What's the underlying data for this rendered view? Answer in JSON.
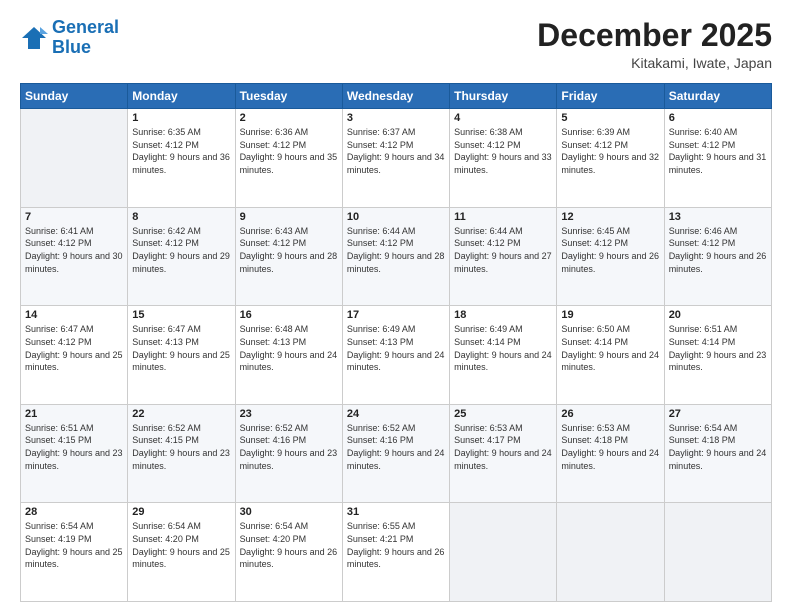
{
  "logo": {
    "line1": "General",
    "line2": "Blue"
  },
  "header": {
    "title": "December 2025",
    "location": "Kitakami, Iwate, Japan"
  },
  "weekdays": [
    "Sunday",
    "Monday",
    "Tuesday",
    "Wednesday",
    "Thursday",
    "Friday",
    "Saturday"
  ],
  "weeks": [
    [
      {
        "day": "",
        "sunrise": "",
        "sunset": "",
        "daylight": ""
      },
      {
        "day": "1",
        "sunrise": "Sunrise: 6:35 AM",
        "sunset": "Sunset: 4:12 PM",
        "daylight": "Daylight: 9 hours and 36 minutes."
      },
      {
        "day": "2",
        "sunrise": "Sunrise: 6:36 AM",
        "sunset": "Sunset: 4:12 PM",
        "daylight": "Daylight: 9 hours and 35 minutes."
      },
      {
        "day": "3",
        "sunrise": "Sunrise: 6:37 AM",
        "sunset": "Sunset: 4:12 PM",
        "daylight": "Daylight: 9 hours and 34 minutes."
      },
      {
        "day": "4",
        "sunrise": "Sunrise: 6:38 AM",
        "sunset": "Sunset: 4:12 PM",
        "daylight": "Daylight: 9 hours and 33 minutes."
      },
      {
        "day": "5",
        "sunrise": "Sunrise: 6:39 AM",
        "sunset": "Sunset: 4:12 PM",
        "daylight": "Daylight: 9 hours and 32 minutes."
      },
      {
        "day": "6",
        "sunrise": "Sunrise: 6:40 AM",
        "sunset": "Sunset: 4:12 PM",
        "daylight": "Daylight: 9 hours and 31 minutes."
      }
    ],
    [
      {
        "day": "7",
        "sunrise": "Sunrise: 6:41 AM",
        "sunset": "Sunset: 4:12 PM",
        "daylight": "Daylight: 9 hours and 30 minutes."
      },
      {
        "day": "8",
        "sunrise": "Sunrise: 6:42 AM",
        "sunset": "Sunset: 4:12 PM",
        "daylight": "Daylight: 9 hours and 29 minutes."
      },
      {
        "day": "9",
        "sunrise": "Sunrise: 6:43 AM",
        "sunset": "Sunset: 4:12 PM",
        "daylight": "Daylight: 9 hours and 28 minutes."
      },
      {
        "day": "10",
        "sunrise": "Sunrise: 6:44 AM",
        "sunset": "Sunset: 4:12 PM",
        "daylight": "Daylight: 9 hours and 28 minutes."
      },
      {
        "day": "11",
        "sunrise": "Sunrise: 6:44 AM",
        "sunset": "Sunset: 4:12 PM",
        "daylight": "Daylight: 9 hours and 27 minutes."
      },
      {
        "day": "12",
        "sunrise": "Sunrise: 6:45 AM",
        "sunset": "Sunset: 4:12 PM",
        "daylight": "Daylight: 9 hours and 26 minutes."
      },
      {
        "day": "13",
        "sunrise": "Sunrise: 6:46 AM",
        "sunset": "Sunset: 4:12 PM",
        "daylight": "Daylight: 9 hours and 26 minutes."
      }
    ],
    [
      {
        "day": "14",
        "sunrise": "Sunrise: 6:47 AM",
        "sunset": "Sunset: 4:12 PM",
        "daylight": "Daylight: 9 hours and 25 minutes."
      },
      {
        "day": "15",
        "sunrise": "Sunrise: 6:47 AM",
        "sunset": "Sunset: 4:13 PM",
        "daylight": "Daylight: 9 hours and 25 minutes."
      },
      {
        "day": "16",
        "sunrise": "Sunrise: 6:48 AM",
        "sunset": "Sunset: 4:13 PM",
        "daylight": "Daylight: 9 hours and 24 minutes."
      },
      {
        "day": "17",
        "sunrise": "Sunrise: 6:49 AM",
        "sunset": "Sunset: 4:13 PM",
        "daylight": "Daylight: 9 hours and 24 minutes."
      },
      {
        "day": "18",
        "sunrise": "Sunrise: 6:49 AM",
        "sunset": "Sunset: 4:14 PM",
        "daylight": "Daylight: 9 hours and 24 minutes."
      },
      {
        "day": "19",
        "sunrise": "Sunrise: 6:50 AM",
        "sunset": "Sunset: 4:14 PM",
        "daylight": "Daylight: 9 hours and 24 minutes."
      },
      {
        "day": "20",
        "sunrise": "Sunrise: 6:51 AM",
        "sunset": "Sunset: 4:14 PM",
        "daylight": "Daylight: 9 hours and 23 minutes."
      }
    ],
    [
      {
        "day": "21",
        "sunrise": "Sunrise: 6:51 AM",
        "sunset": "Sunset: 4:15 PM",
        "daylight": "Daylight: 9 hours and 23 minutes."
      },
      {
        "day": "22",
        "sunrise": "Sunrise: 6:52 AM",
        "sunset": "Sunset: 4:15 PM",
        "daylight": "Daylight: 9 hours and 23 minutes."
      },
      {
        "day": "23",
        "sunrise": "Sunrise: 6:52 AM",
        "sunset": "Sunset: 4:16 PM",
        "daylight": "Daylight: 9 hours and 23 minutes."
      },
      {
        "day": "24",
        "sunrise": "Sunrise: 6:52 AM",
        "sunset": "Sunset: 4:16 PM",
        "daylight": "Daylight: 9 hours and 24 minutes."
      },
      {
        "day": "25",
        "sunrise": "Sunrise: 6:53 AM",
        "sunset": "Sunset: 4:17 PM",
        "daylight": "Daylight: 9 hours and 24 minutes."
      },
      {
        "day": "26",
        "sunrise": "Sunrise: 6:53 AM",
        "sunset": "Sunset: 4:18 PM",
        "daylight": "Daylight: 9 hours and 24 minutes."
      },
      {
        "day": "27",
        "sunrise": "Sunrise: 6:54 AM",
        "sunset": "Sunset: 4:18 PM",
        "daylight": "Daylight: 9 hours and 24 minutes."
      }
    ],
    [
      {
        "day": "28",
        "sunrise": "Sunrise: 6:54 AM",
        "sunset": "Sunset: 4:19 PM",
        "daylight": "Daylight: 9 hours and 25 minutes."
      },
      {
        "day": "29",
        "sunrise": "Sunrise: 6:54 AM",
        "sunset": "Sunset: 4:20 PM",
        "daylight": "Daylight: 9 hours and 25 minutes."
      },
      {
        "day": "30",
        "sunrise": "Sunrise: 6:54 AM",
        "sunset": "Sunset: 4:20 PM",
        "daylight": "Daylight: 9 hours and 26 minutes."
      },
      {
        "day": "31",
        "sunrise": "Sunrise: 6:55 AM",
        "sunset": "Sunset: 4:21 PM",
        "daylight": "Daylight: 9 hours and 26 minutes."
      },
      {
        "day": "",
        "sunrise": "",
        "sunset": "",
        "daylight": ""
      },
      {
        "day": "",
        "sunrise": "",
        "sunset": "",
        "daylight": ""
      },
      {
        "day": "",
        "sunrise": "",
        "sunset": "",
        "daylight": ""
      }
    ]
  ]
}
